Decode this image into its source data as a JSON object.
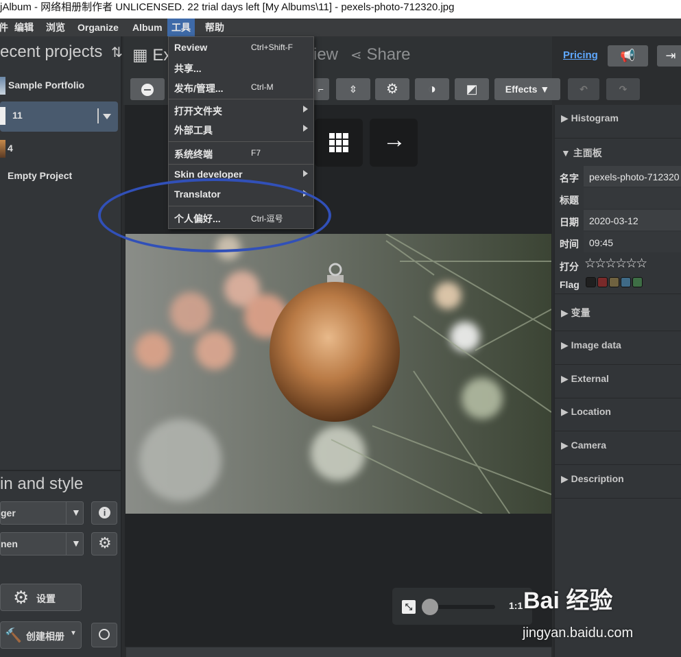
{
  "window": {
    "title": "jAlbum - 网络相册制作者 UNLICENSED. 22 trial days left [My Albums\\11] - pexels-photo-712320.jpg"
  },
  "menubar": {
    "items": [
      {
        "label": "件"
      },
      {
        "label": "编辑"
      },
      {
        "label": "浏览"
      },
      {
        "label": "Organize"
      },
      {
        "label": "Album"
      },
      {
        "label": "工具"
      },
      {
        "label": "帮助"
      }
    ]
  },
  "left": {
    "header": "ecent projects",
    "projects": [
      {
        "label": "Sample Portfolio"
      },
      {
        "label": "11"
      },
      {
        "label": "4"
      },
      {
        "label": "Empty Project"
      }
    ],
    "skin_header": "in and style",
    "skin_select": "ger",
    "style_select": "nen",
    "settings_label": "设置",
    "make_label": "创建相册"
  },
  "center": {
    "tab_explore": "Ex",
    "tab_preview": "iew",
    "tab_share": "Share",
    "pricing": "Pricing",
    "effects_label": "Effects"
  },
  "menu": {
    "items": [
      {
        "label": "Review",
        "shortcut": "Ctrl+Shift-F"
      },
      {
        "label": "共享..."
      },
      {
        "label": "发布/管理...",
        "shortcut": "Ctrl-M"
      },
      {
        "label": "打开文件夹"
      },
      {
        "label": "外部工具"
      },
      {
        "label": "系统终端",
        "shortcut": "F7"
      },
      {
        "label": "Skin developer"
      },
      {
        "label": "Translator"
      },
      {
        "label": "个人偏好...",
        "shortcut": "Ctrl-逗号"
      }
    ]
  },
  "right": {
    "histogram": "Histogram",
    "main_panel": "主面板",
    "props": [
      {
        "key": "名字",
        "value": "pexels-photo-712320"
      },
      {
        "key": "标题",
        "value": ""
      },
      {
        "key": "日期",
        "value": "2020-03-12"
      },
      {
        "key": "时间",
        "value": "09:45"
      }
    ],
    "rating_label": "打分",
    "flag_label": "Flag",
    "flag_colors": [
      "#1f1f1f",
      "#7a2a2a",
      "#6f6240",
      "#3f6a86",
      "#3e6e45"
    ],
    "sections": [
      {
        "label": "变量"
      },
      {
        "label": "Image data"
      },
      {
        "label": "External"
      },
      {
        "label": "Location"
      },
      {
        "label": "Camera"
      },
      {
        "label": "Description"
      }
    ]
  },
  "zoom": {
    "label": "1:1"
  },
  "watermark": {
    "brand": "Bai 经验",
    "url": "jingyan.baidu.com"
  }
}
